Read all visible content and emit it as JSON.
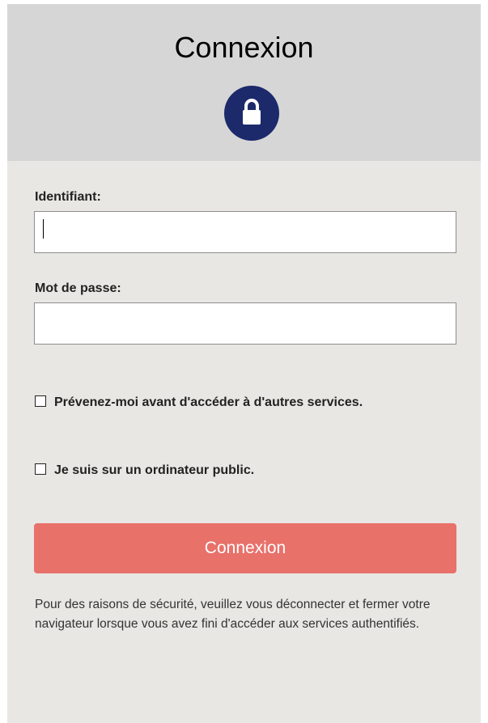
{
  "header": {
    "title": "Connexion",
    "icon": "lock-icon",
    "icon_color": "#1c2a6b",
    "background": "#d6d6d6"
  },
  "form": {
    "username_label": "Identifiant:",
    "username_value": "",
    "password_label": "Mot de passe:",
    "password_value": "",
    "warn_checkbox_label": "Prévenez-moi avant d'accéder à d'autres services.",
    "warn_checked": false,
    "public_checkbox_label": "Je suis sur un ordinateur public.",
    "public_checked": false,
    "submit_label": "Connexion",
    "submit_color": "#e8716a"
  },
  "footer": {
    "notice": "Pour des raisons de sécurité, veuillez vous déconnecter et fermer votre navigateur lorsque vous avez fini d'accéder aux services authentifiés."
  }
}
